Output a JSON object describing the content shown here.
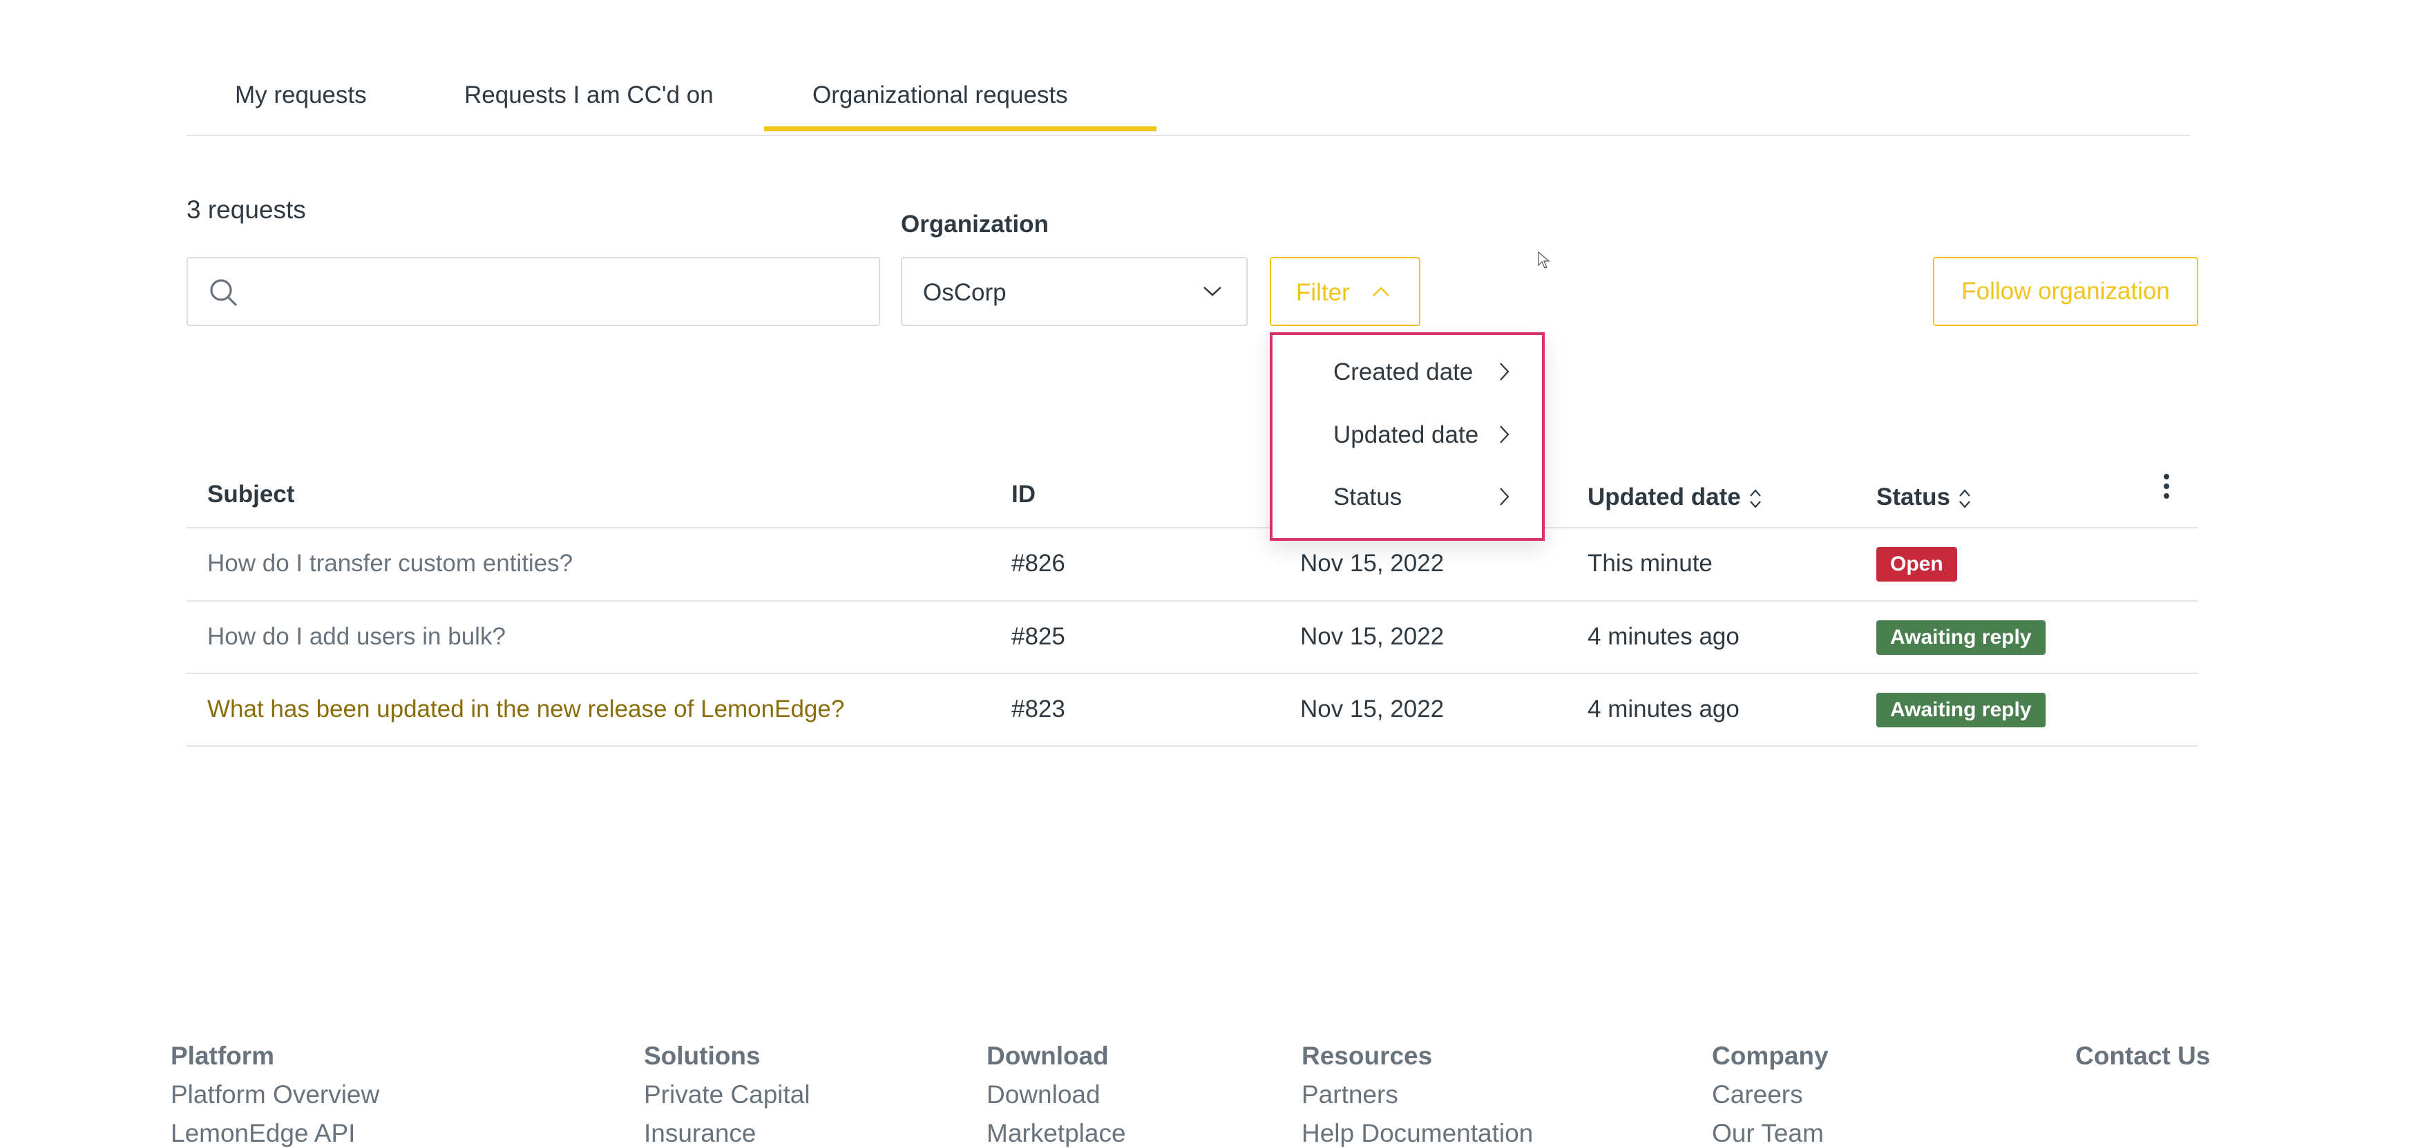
{
  "tabs": [
    {
      "label": "My requests",
      "active": false
    },
    {
      "label": "Requests I am CC'd on",
      "active": false
    },
    {
      "label": "Organizational requests",
      "active": true
    }
  ],
  "request_count": "3 requests",
  "search": {
    "value": "",
    "placeholder": "",
    "icon": "search-icon"
  },
  "organization": {
    "label": "Organization",
    "selected": "OsCorp"
  },
  "filter": {
    "label": "Filter",
    "expanded": true
  },
  "follow_button": "Follow organization",
  "filter_menu": {
    "items": [
      {
        "label": "Created date"
      },
      {
        "label": "Updated date"
      },
      {
        "label": "Status"
      }
    ]
  },
  "table": {
    "headers": {
      "subject": "Subject",
      "id": "ID",
      "updated": "Updated date",
      "status": "Status"
    },
    "rows": [
      {
        "subject": "How do I transfer custom entities?",
        "id": "#826",
        "created": "Nov 15, 2022",
        "updated": "This minute",
        "status": "Open"
      },
      {
        "subject": "How do I add users in bulk?",
        "id": "#825",
        "created": "Nov 15, 2022",
        "updated": "4 minutes ago",
        "status": "Awaiting reply"
      },
      {
        "subject": "What has been updated in the new release of LemonEdge?",
        "id": "#823",
        "created": "Nov 15, 2022",
        "updated": "4 minutes ago",
        "status": "Awaiting reply"
      }
    ]
  },
  "footer": {
    "columns": [
      {
        "heading": "Platform",
        "links": [
          "Platform Overview",
          "LemonEdge API"
        ]
      },
      {
        "heading": "Solutions",
        "links": [
          "Private Capital",
          "Insurance"
        ]
      },
      {
        "heading": "Download",
        "links": [
          "Download",
          "Marketplace"
        ]
      },
      {
        "heading": "Resources",
        "links": [
          "Partners",
          "Help Documentation"
        ]
      },
      {
        "heading": "Company",
        "links": [
          "Careers",
          "Our Team"
        ]
      },
      {
        "heading": "Contact Us",
        "links": []
      }
    ]
  },
  "colors": {
    "accent": "#f0c419",
    "menu_border": "#d6336c",
    "badge_open": "#c72a3c",
    "badge_awaiting": "#4a7f4f",
    "link_highlight": "#8a6d0b"
  }
}
